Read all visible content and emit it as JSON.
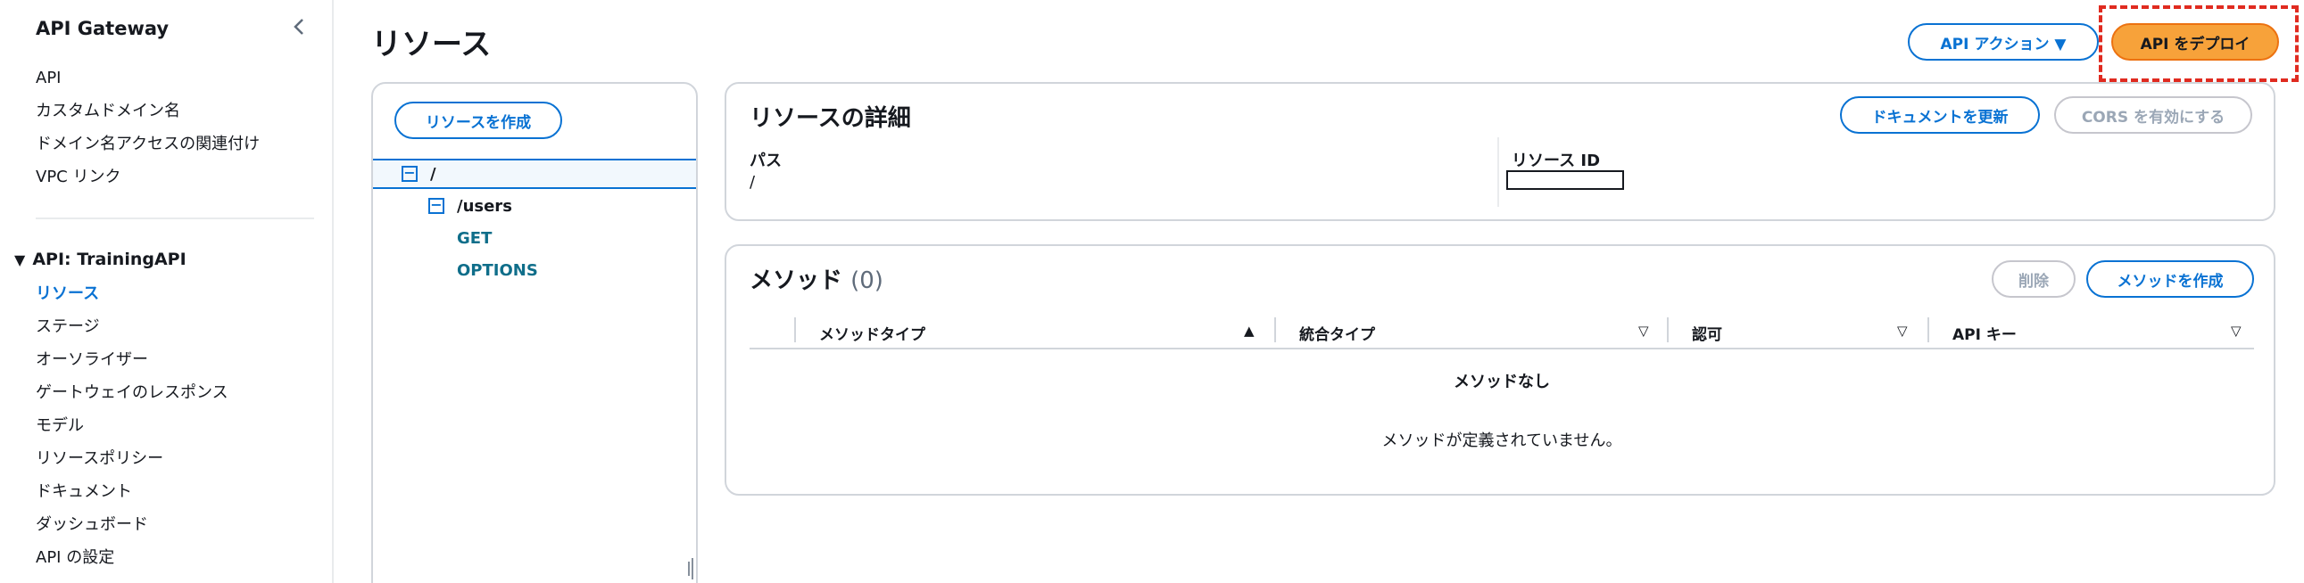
{
  "sidebar": {
    "title": "API Gateway",
    "collapse_icon": "chevron-left-icon",
    "top_items": [
      {
        "label": "API"
      },
      {
        "label": "カスタムドメイン名"
      },
      {
        "label": "ドメイン名アクセスの関連付け"
      },
      {
        "label": "VPC リンク"
      }
    ],
    "group_title": "API: TrainingAPI",
    "group_items": [
      {
        "label": "リソース",
        "active": true
      },
      {
        "label": "ステージ"
      },
      {
        "label": "オーソライザー"
      },
      {
        "label": "ゲートウェイのレスポンス"
      },
      {
        "label": "モデル"
      },
      {
        "label": "リソースポリシー"
      },
      {
        "label": "ドキュメント"
      },
      {
        "label": "ダッシュボード"
      },
      {
        "label": "API の設定"
      }
    ]
  },
  "header": {
    "title": "リソース",
    "api_actions_label": "API アクション ▼",
    "deploy_label": "API をデプロイ"
  },
  "tree": {
    "create_button": "リソースを作成",
    "root_path": "/",
    "child_path": "/users",
    "methods": [
      "GET",
      "OPTIONS"
    ]
  },
  "details": {
    "title": "リソースの詳細",
    "update_docs_button": "ドキュメントを更新",
    "cors_button": "CORS を有効にする",
    "path_label": "パス",
    "path_value": "/",
    "resource_id_label": "リソース ID",
    "resource_id_value": ""
  },
  "methods": {
    "title": "メソッド",
    "count": "(0)",
    "delete_button": "削除",
    "create_button": "メソッドを作成",
    "columns": [
      "メソッドタイプ",
      "統合タイプ",
      "認可",
      "API キー"
    ],
    "empty_title": "メソッドなし",
    "empty_text": "メソッドが定義されていません。"
  },
  "colors": {
    "link_blue": "#0972d3",
    "primary_orange": "#f7a23a",
    "highlight_red": "#e02b20"
  }
}
